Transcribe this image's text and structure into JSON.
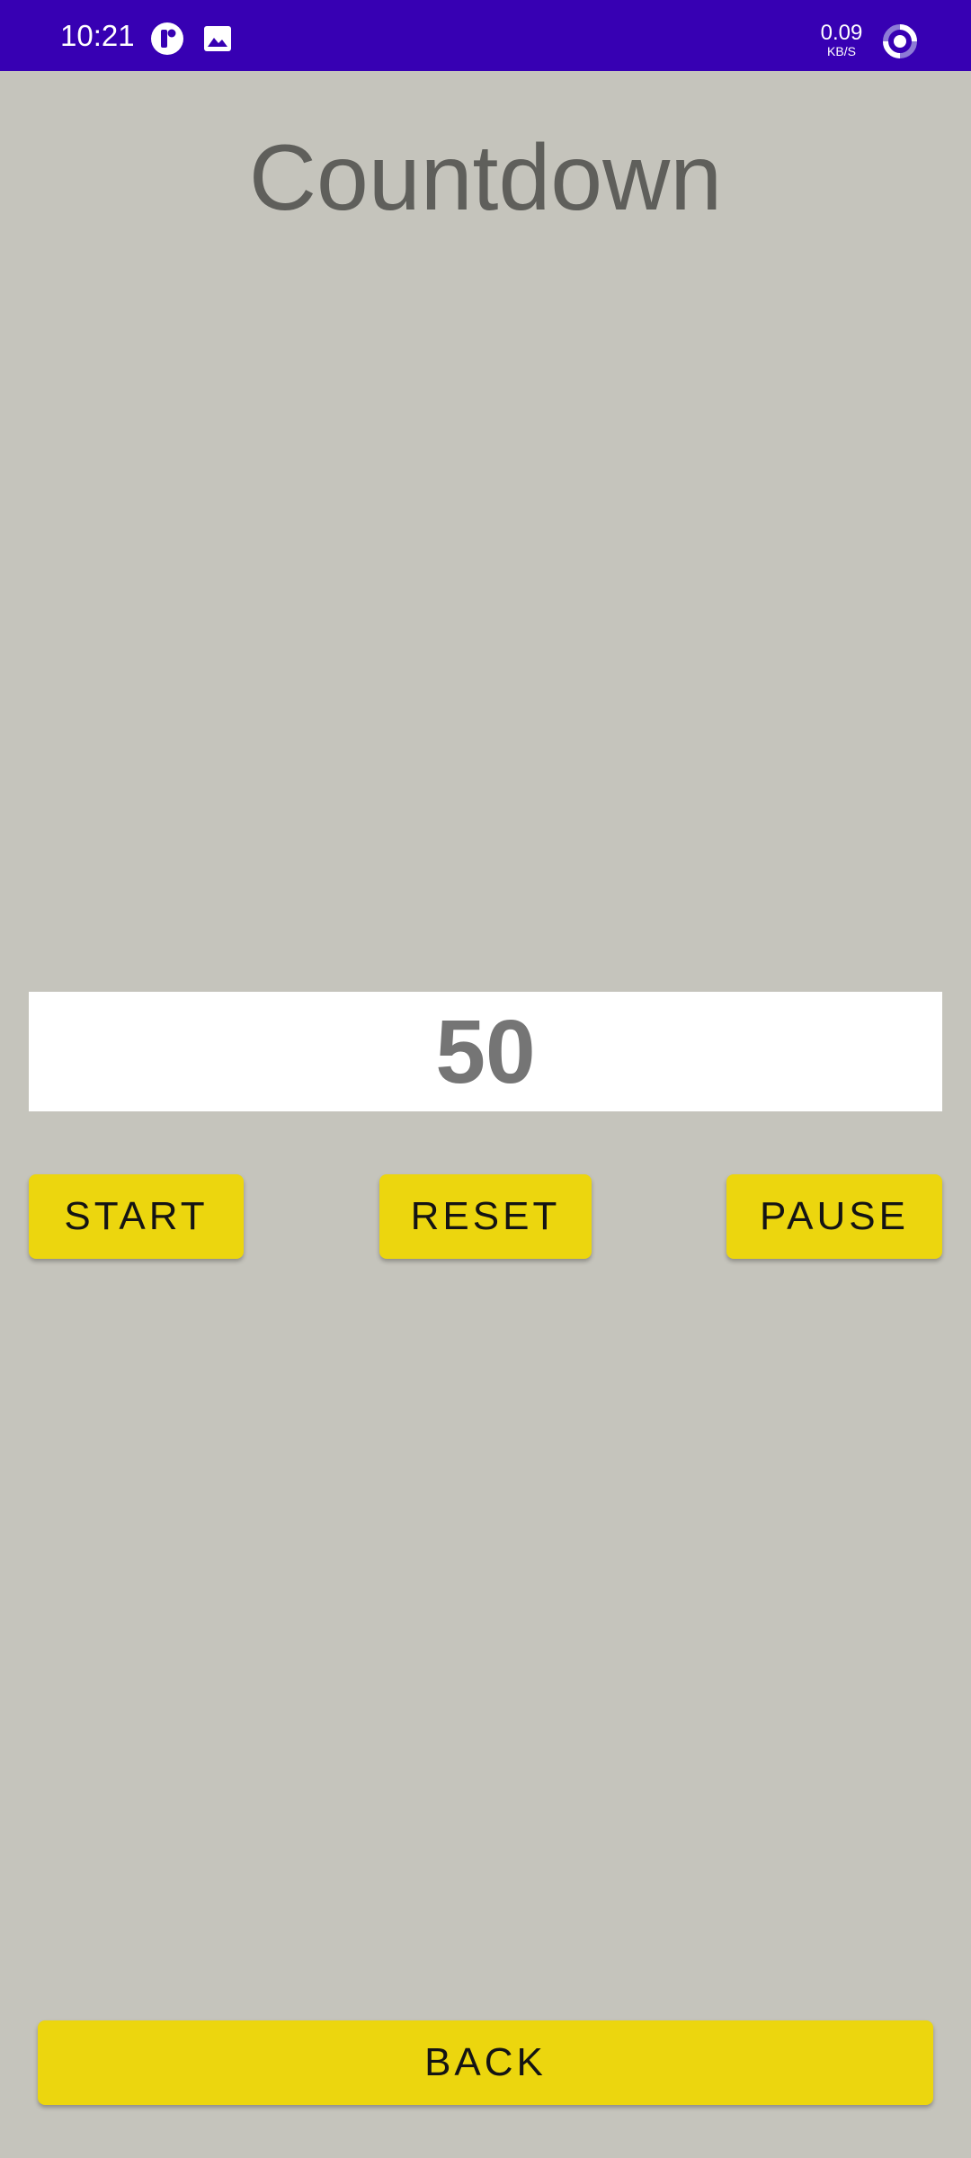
{
  "status_bar": {
    "time": "10:21",
    "net_speed_value": "0.09",
    "net_speed_unit": "KB/S",
    "icons": [
      "app-notification-icon",
      "image-icon",
      "data-saver-icon"
    ],
    "background_color": "#3700b3"
  },
  "screen": {
    "title": "Countdown",
    "background_color": "#c5c4bc"
  },
  "countdown": {
    "value": "50"
  },
  "controls": {
    "start_label": "START",
    "reset_label": "RESET",
    "pause_label": "PAUSE",
    "back_label": "BACK",
    "button_color": "#ecd60e"
  }
}
